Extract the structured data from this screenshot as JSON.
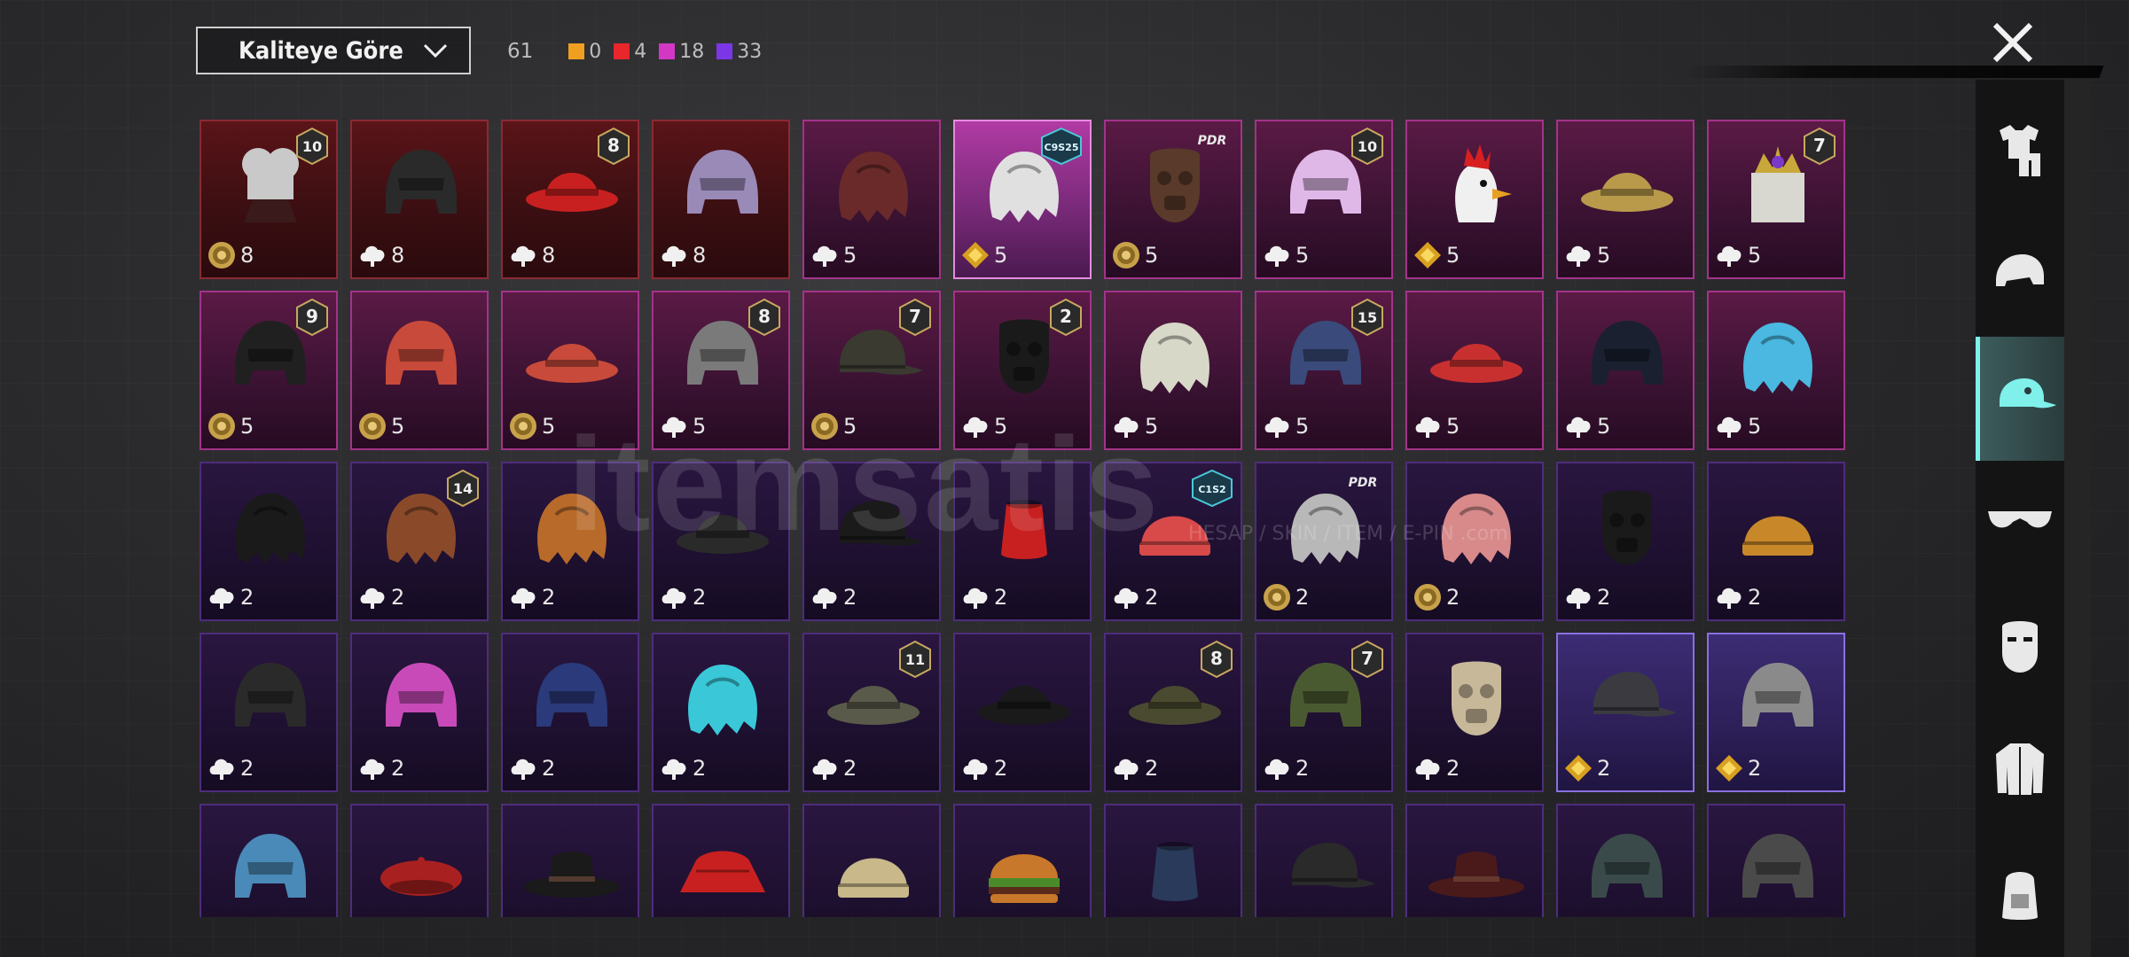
{
  "toolbar": {
    "sort_label": "Kaliteye Göre",
    "total_count": "61",
    "quality_counts": [
      {
        "color": "#f0a020",
        "value": "0"
      },
      {
        "color": "#e8262c",
        "value": "4"
      },
      {
        "color": "#d238c4",
        "value": "18"
      },
      {
        "color": "#7b36e8",
        "value": "33"
      }
    ]
  },
  "sidebar": {
    "items": [
      {
        "icon": "outfit-icon"
      },
      {
        "icon": "helmet-icon"
      },
      {
        "icon": "cap-icon",
        "active": true
      },
      {
        "icon": "glasses-icon"
      },
      {
        "icon": "mask-icon"
      },
      {
        "icon": "jacket-icon"
      },
      {
        "icon": "backpack-icon"
      }
    ]
  },
  "watermark": {
    "main": "itemsatis",
    "sub": "HESAP / SKIN / ITEM / E-PIN  .com"
  },
  "items": [
    {
      "q": "red",
      "cur": "gold",
      "qty": "8",
      "badge": "10",
      "badge_type": "num",
      "shape": "chef-hat",
      "color": "#c9c9c9"
    },
    {
      "q": "red",
      "cur": "cloud",
      "qty": "8",
      "badge": "",
      "shape": "helmet",
      "color": "#2a2a2a"
    },
    {
      "q": "red",
      "cur": "cloud",
      "qty": "8",
      "badge": "8",
      "badge_type": "num",
      "shape": "hat",
      "color": "#c82020"
    },
    {
      "q": "red",
      "cur": "cloud",
      "qty": "8",
      "badge": "",
      "shape": "helmet",
      "color": "#9a8ab8"
    },
    {
      "q": "pink",
      "cur": "cloud",
      "qty": "5",
      "badge": "",
      "shape": "hair",
      "color": "#6a2a2a"
    },
    {
      "q": "sel",
      "cur": "diamond",
      "qty": "5",
      "badge": "C9S25",
      "badge_type": "season",
      "shape": "hair",
      "color": "#e0e0e0"
    },
    {
      "q": "pink",
      "cur": "gold",
      "qty": "5",
      "badge": "PDR",
      "badge_type": "tag",
      "shape": "mask",
      "color": "#5a3a2a"
    },
    {
      "q": "pink",
      "cur": "cloud",
      "qty": "5",
      "badge": "10",
      "badge_type": "num",
      "shape": "helmet",
      "color": "#e0b8e8"
    },
    {
      "q": "pink",
      "cur": "diamond",
      "qty": "5",
      "badge": "",
      "shape": "rooster",
      "color": "#f0f0f0"
    },
    {
      "q": "pink",
      "cur": "cloud",
      "qty": "5",
      "badge": "",
      "shape": "hat",
      "color": "#b89a4a"
    },
    {
      "q": "pink",
      "cur": "cloud",
      "qty": "5",
      "badge": "7",
      "badge_type": "num",
      "shape": "crown",
      "color": "#d8d8d0"
    },
    {
      "q": "pink",
      "cur": "gold",
      "qty": "5",
      "badge": "9",
      "badge_type": "num",
      "shape": "helmet",
      "color": "#202020"
    },
    {
      "q": "pink",
      "cur": "gold",
      "qty": "5",
      "badge": "",
      "shape": "helmet",
      "color": "#c84a3a"
    },
    {
      "q": "pink",
      "cur": "gold",
      "qty": "5",
      "badge": "",
      "shape": "hat",
      "color": "#c84a3a"
    },
    {
      "q": "pink",
      "cur": "cloud",
      "qty": "5",
      "badge": "8",
      "badge_type": "num",
      "shape": "helmet",
      "color": "#7a7a7a"
    },
    {
      "q": "pink",
      "cur": "gold",
      "qty": "5",
      "badge": "7",
      "badge_type": "num",
      "shape": "cap",
      "color": "#3a3a30"
    },
    {
      "q": "pink",
      "cur": "cloud",
      "qty": "5",
      "badge": "2",
      "badge_type": "num",
      "shape": "mask",
      "color": "#1a1a1a"
    },
    {
      "q": "pink",
      "cur": "cloud",
      "qty": "5",
      "badge": "",
      "shape": "hair",
      "color": "#d8d8c8"
    },
    {
      "q": "pink",
      "cur": "cloud",
      "qty": "5",
      "badge": "15",
      "badge_type": "num",
      "shape": "helmet",
      "color": "#3a4a7a"
    },
    {
      "q": "pink",
      "cur": "cloud",
      "qty": "5",
      "badge": "",
      "shape": "hat",
      "color": "#c83030"
    },
    {
      "q": "pink",
      "cur": "cloud",
      "qty": "5",
      "badge": "",
      "shape": "helmet",
      "color": "#1a2030"
    },
    {
      "q": "pink",
      "cur": "cloud",
      "qty": "5",
      "badge": "",
      "shape": "hair",
      "color": "#4ab8e0"
    },
    {
      "q": "purple",
      "cur": "cloud",
      "qty": "2",
      "badge": "",
      "shape": "hair",
      "color": "#1a1a1a"
    },
    {
      "q": "purple",
      "cur": "cloud",
      "qty": "2",
      "badge": "14",
      "badge_type": "num",
      "shape": "hair",
      "color": "#8a4a2a"
    },
    {
      "q": "purple",
      "cur": "cloud",
      "qty": "2",
      "badge": "",
      "shape": "hair",
      "color": "#b86a2a"
    },
    {
      "q": "purple",
      "cur": "cloud",
      "qty": "2",
      "badge": "",
      "shape": "hat",
      "color": "#2a2a2a"
    },
    {
      "q": "purple",
      "cur": "cloud",
      "qty": "2",
      "badge": "",
      "shape": "cap",
      "color": "#1a1a1a"
    },
    {
      "q": "purple",
      "cur": "cloud",
      "qty": "2",
      "badge": "",
      "shape": "fez",
      "color": "#c82020"
    },
    {
      "q": "purple",
      "cur": "cloud",
      "qty": "2",
      "badge": "C1S2",
      "badge_type": "season",
      "shape": "beanie",
      "color": "#d84a4a"
    },
    {
      "q": "purple",
      "cur": "gold",
      "qty": "2",
      "badge": "PDR",
      "badge_type": "tag",
      "shape": "hair",
      "color": "#b8b8b8"
    },
    {
      "q": "purple",
      "cur": "gold",
      "qty": "2",
      "badge": "",
      "shape": "hair",
      "color": "#d88a8a"
    },
    {
      "q": "purple",
      "cur": "cloud",
      "qty": "2",
      "badge": "",
      "shape": "mask",
      "color": "#1a1a1a"
    },
    {
      "q": "purple",
      "cur": "cloud",
      "qty": "2",
      "badge": "",
      "shape": "beanie",
      "color": "#c8882a"
    },
    {
      "q": "purple",
      "cur": "cloud",
      "qty": "2",
      "badge": "",
      "shape": "helmet",
      "color": "#2a2a2a"
    },
    {
      "q": "purple",
      "cur": "cloud",
      "qty": "2",
      "badge": "",
      "shape": "helmet",
      "color": "#c84ab8"
    },
    {
      "q": "purple",
      "cur": "cloud",
      "qty": "2",
      "badge": "",
      "shape": "helmet",
      "color": "#2a3a7a"
    },
    {
      "q": "purple",
      "cur": "cloud",
      "qty": "2",
      "badge": "",
      "shape": "hair",
      "color": "#3ac8d8"
    },
    {
      "q": "purple",
      "cur": "cloud",
      "qty": "2",
      "badge": "11",
      "badge_type": "num",
      "shape": "hat",
      "color": "#5a5a4a"
    },
    {
      "q": "purple",
      "cur": "cloud",
      "qty": "2",
      "badge": "",
      "shape": "hat",
      "color": "#1a1a1a"
    },
    {
      "q": "purple",
      "cur": "cloud",
      "qty": "2",
      "badge": "8",
      "badge_type": "num",
      "shape": "hat",
      "color": "#4a4a30"
    },
    {
      "q": "purple",
      "cur": "cloud",
      "qty": "2",
      "badge": "7",
      "badge_type": "num",
      "shape": "helmet",
      "color": "#4a5a30"
    },
    {
      "q": "purple",
      "cur": "cloud",
      "qty": "2",
      "badge": "",
      "shape": "mask",
      "color": "#c8b89a"
    },
    {
      "q": "ltpurple",
      "cur": "diamond",
      "qty": "2",
      "badge": "",
      "shape": "cap",
      "color": "#3a3a40"
    },
    {
      "q": "ltpurple",
      "cur": "diamond",
      "qty": "2",
      "badge": "",
      "shape": "helmet",
      "color": "#8a8a8a"
    },
    {
      "q": "purple",
      "cur": "",
      "qty": "",
      "badge": "",
      "shape": "helmet",
      "color": "#4a8ab8"
    },
    {
      "q": "purple",
      "cur": "",
      "qty": "",
      "badge": "",
      "shape": "beret",
      "color": "#a82020"
    },
    {
      "q": "purple",
      "cur": "",
      "qty": "",
      "badge": "",
      "shape": "fedora",
      "color": "#1a1a1a"
    },
    {
      "q": "purple",
      "cur": "",
      "qty": "",
      "badge": "",
      "shape": "bucket",
      "color": "#c82020"
    },
    {
      "q": "purple",
      "cur": "",
      "qty": "",
      "badge": "",
      "shape": "beanie",
      "color": "#c8b88a"
    },
    {
      "q": "purple",
      "cur": "",
      "qty": "",
      "badge": "",
      "shape": "burger",
      "color": "#c8782a"
    },
    {
      "q": "purple",
      "cur": "",
      "qty": "",
      "badge": "",
      "shape": "fez",
      "color": "#2a3a5a"
    },
    {
      "q": "purple",
      "cur": "",
      "qty": "",
      "badge": "",
      "shape": "cap",
      "color": "#2a2a2a"
    },
    {
      "q": "purple",
      "cur": "",
      "qty": "",
      "badge": "",
      "shape": "fedora",
      "color": "#4a1a1a"
    },
    {
      "q": "purple",
      "cur": "",
      "qty": "",
      "badge": "",
      "shape": "helmet",
      "color": "#3a4a4a"
    },
    {
      "q": "purple",
      "cur": "",
      "qty": "",
      "badge": "",
      "shape": "helmet",
      "color": "#4a4a4a"
    }
  ]
}
